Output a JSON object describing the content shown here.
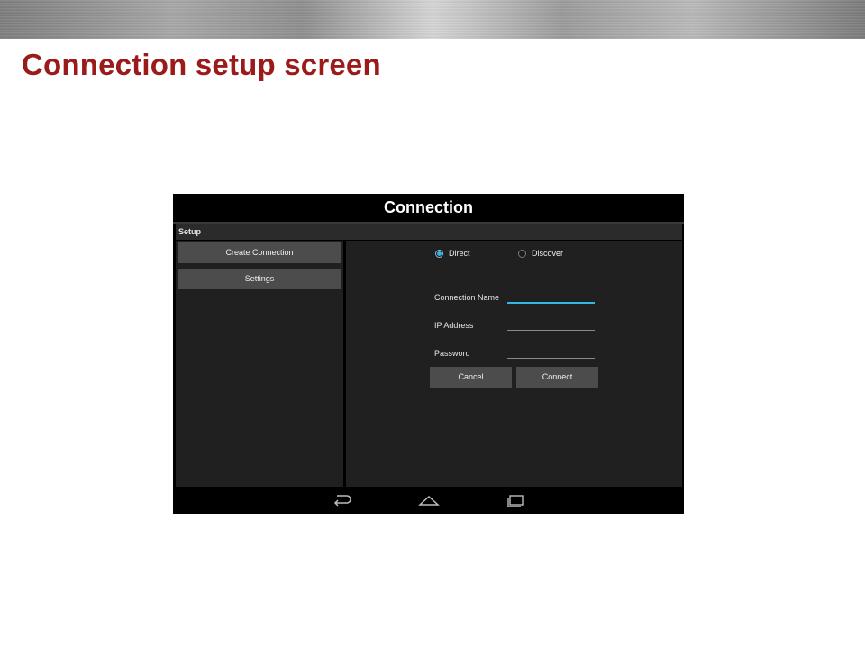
{
  "slide": {
    "title": "Connection setup screen"
  },
  "app": {
    "title": "Connection",
    "section_header": "Setup"
  },
  "sidebar": {
    "items": [
      {
        "label": "Create Connection"
      },
      {
        "label": "Settings"
      }
    ]
  },
  "form": {
    "mode_options": [
      {
        "label": "Direct",
        "selected": true
      },
      {
        "label": "Discover",
        "selected": false
      }
    ],
    "fields": [
      {
        "label": "Connection Name",
        "value": ""
      },
      {
        "label": "IP Address",
        "value": ""
      },
      {
        "label": "Password",
        "value": ""
      }
    ],
    "cancel_label": "Cancel",
    "connect_label": "Connect"
  },
  "navbar": {
    "icons": [
      "back-icon",
      "home-icon",
      "recent-apps-icon"
    ]
  },
  "colors": {
    "title_red": "#9b1b1b",
    "accent_blue": "#33b5e5",
    "button_gray": "#4c4c4c",
    "panel_dark": "#202020"
  }
}
